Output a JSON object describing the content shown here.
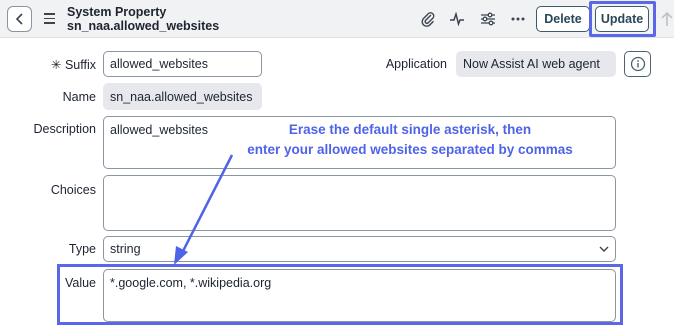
{
  "header": {
    "title_line1": "System Property",
    "title_line2": "sn_naa.allowed_websites",
    "delete_label": "Delete",
    "update_label": "Update",
    "icons": [
      "chevron-left-icon",
      "menu-icon",
      "paperclip-icon",
      "activity-icon",
      "sliders-icon",
      "more-icon",
      "arrow-up-icon"
    ]
  },
  "form": {
    "suffix_label": "Suffix",
    "required_mark": "✳",
    "suffix_value": "allowed_websites",
    "application_label": "Application",
    "application_value": "Now Assist AI web agent",
    "name_label": "Name",
    "name_value": "sn_naa.allowed_websites",
    "description_label": "Description",
    "description_value": "allowed_websites",
    "choices_label": "Choices",
    "choices_value": "",
    "type_label": "Type",
    "type_value": "string",
    "value_label": "Value",
    "value_value": "*.google.com, *.wikipedia.org"
  },
  "annotation": {
    "line1": "Erase the default single asterisk, then",
    "line2": "enter your allowed websites separated by commas"
  },
  "colors": {
    "accent": "#5a67e6",
    "annotation_text": "#4f63e8",
    "header_bg": "#f1f2f4"
  }
}
